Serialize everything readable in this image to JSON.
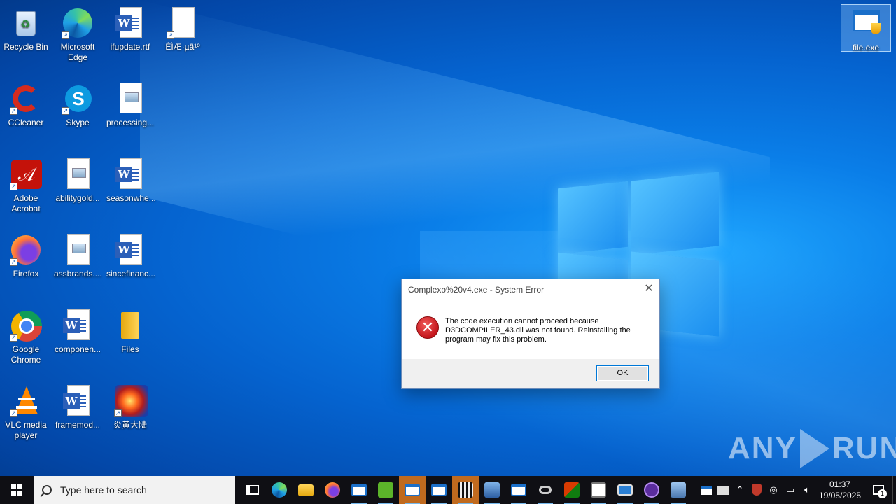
{
  "desktop": {
    "icons": [
      {
        "label": "Recycle Bin",
        "icon": "recycle-bin-icon"
      },
      {
        "label": "Microsoft Edge",
        "icon": "edge-icon"
      },
      {
        "label": "ifupdate.rtf",
        "icon": "word-doc-icon"
      },
      {
        "label": "ÊÌÆ·µã¹º",
        "icon": "blank-file-icon"
      },
      {
        "label": "CCleaner",
        "icon": "ccleaner-icon"
      },
      {
        "label": "Skype",
        "icon": "skype-icon"
      },
      {
        "label": "processing...",
        "icon": "image-file-icon"
      },
      {
        "label": "Adobe Acrobat",
        "icon": "acrobat-icon"
      },
      {
        "label": "abilitygold...",
        "icon": "image-file-icon"
      },
      {
        "label": "seasonwhe...",
        "icon": "word-doc-icon"
      },
      {
        "label": "Firefox",
        "icon": "firefox-icon"
      },
      {
        "label": "assbrands....",
        "icon": "image-file-icon"
      },
      {
        "label": "sincefinanc...",
        "icon": "word-doc-icon"
      },
      {
        "label": "Google Chrome",
        "icon": "chrome-icon"
      },
      {
        "label": "componen...",
        "icon": "word-doc-icon"
      },
      {
        "label": "Files",
        "icon": "folder-icon"
      },
      {
        "label": "VLC media player",
        "icon": "vlc-icon"
      },
      {
        "label": "framemod...",
        "icon": "word-doc-icon"
      },
      {
        "label": "炎黄大陆",
        "icon": "game-icon"
      },
      {
        "label": "file.exe",
        "icon": "exe-file-icon"
      }
    ]
  },
  "dialog": {
    "title": "Complexo%20v4.exe - System Error",
    "message": "The code execution cannot proceed because D3DCOMPILER_43.dll was not found. Reinstalling the program may fix this problem.",
    "ok_label": "OK",
    "close_glyph": "✕",
    "error_glyph": "✕"
  },
  "watermark": {
    "left": "ANY",
    "right": "RUN"
  },
  "taskbar": {
    "search_placeholder": "Type here to search",
    "time": "01:37",
    "date": "19/05/2025",
    "notification_count": "1",
    "colors": {
      "background": "#0f0f14",
      "accent": "#0078d7"
    }
  }
}
